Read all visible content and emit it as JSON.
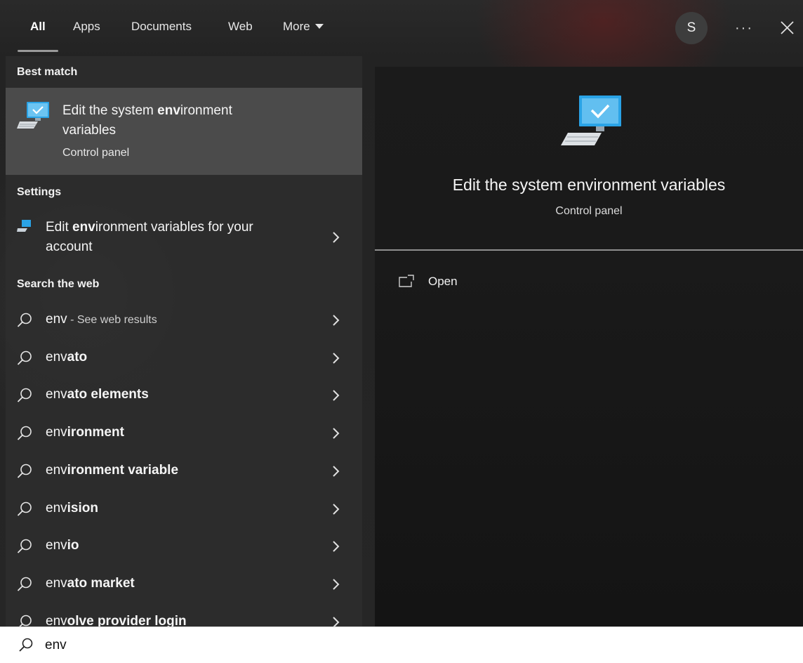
{
  "tabs": [
    {
      "label": "All",
      "active": true
    },
    {
      "label": "Apps",
      "active": false
    },
    {
      "label": "Documents",
      "active": false
    },
    {
      "label": "Web",
      "active": false
    },
    {
      "label": "More",
      "active": false
    }
  ],
  "user": {
    "initial": "S"
  },
  "more_options_label": "···",
  "sections": {
    "best_match": "Best match",
    "settings": "Settings",
    "search_web": "Search the web"
  },
  "best_match": {
    "title_pre": "Edit the system ",
    "title_bold": "env",
    "title_post": "ironment variables",
    "subtitle": "Control panel"
  },
  "settings_item": {
    "title_pre": "Edit ",
    "title_bold": "env",
    "title_post": "ironment variables for your account"
  },
  "web_results": [
    {
      "plain": "env",
      "bold": "",
      "suffix": " - See web results"
    },
    {
      "plain": "env",
      "bold": "ato",
      "suffix": ""
    },
    {
      "plain": "env",
      "bold": "ato elements",
      "suffix": ""
    },
    {
      "plain": "env",
      "bold": "ironment",
      "suffix": ""
    },
    {
      "plain": "env",
      "bold": "ironment variable",
      "suffix": ""
    },
    {
      "plain": "env",
      "bold": "ision",
      "suffix": ""
    },
    {
      "plain": "env",
      "bold": "io",
      "suffix": ""
    },
    {
      "plain": "env",
      "bold": "ato market",
      "suffix": ""
    },
    {
      "plain": "env",
      "bold": "olve provider login",
      "suffix": ""
    }
  ],
  "preview": {
    "title": "Edit the system environment variables",
    "subtitle": "Control panel",
    "open_label": "Open"
  },
  "search": {
    "query": "env"
  },
  "colors": {
    "accent_blue": "#2aa3e6",
    "panel_bg": "#2e2e2e",
    "selected_bg": "#4b4b4b",
    "preview_bg": "#1a1a1a"
  }
}
